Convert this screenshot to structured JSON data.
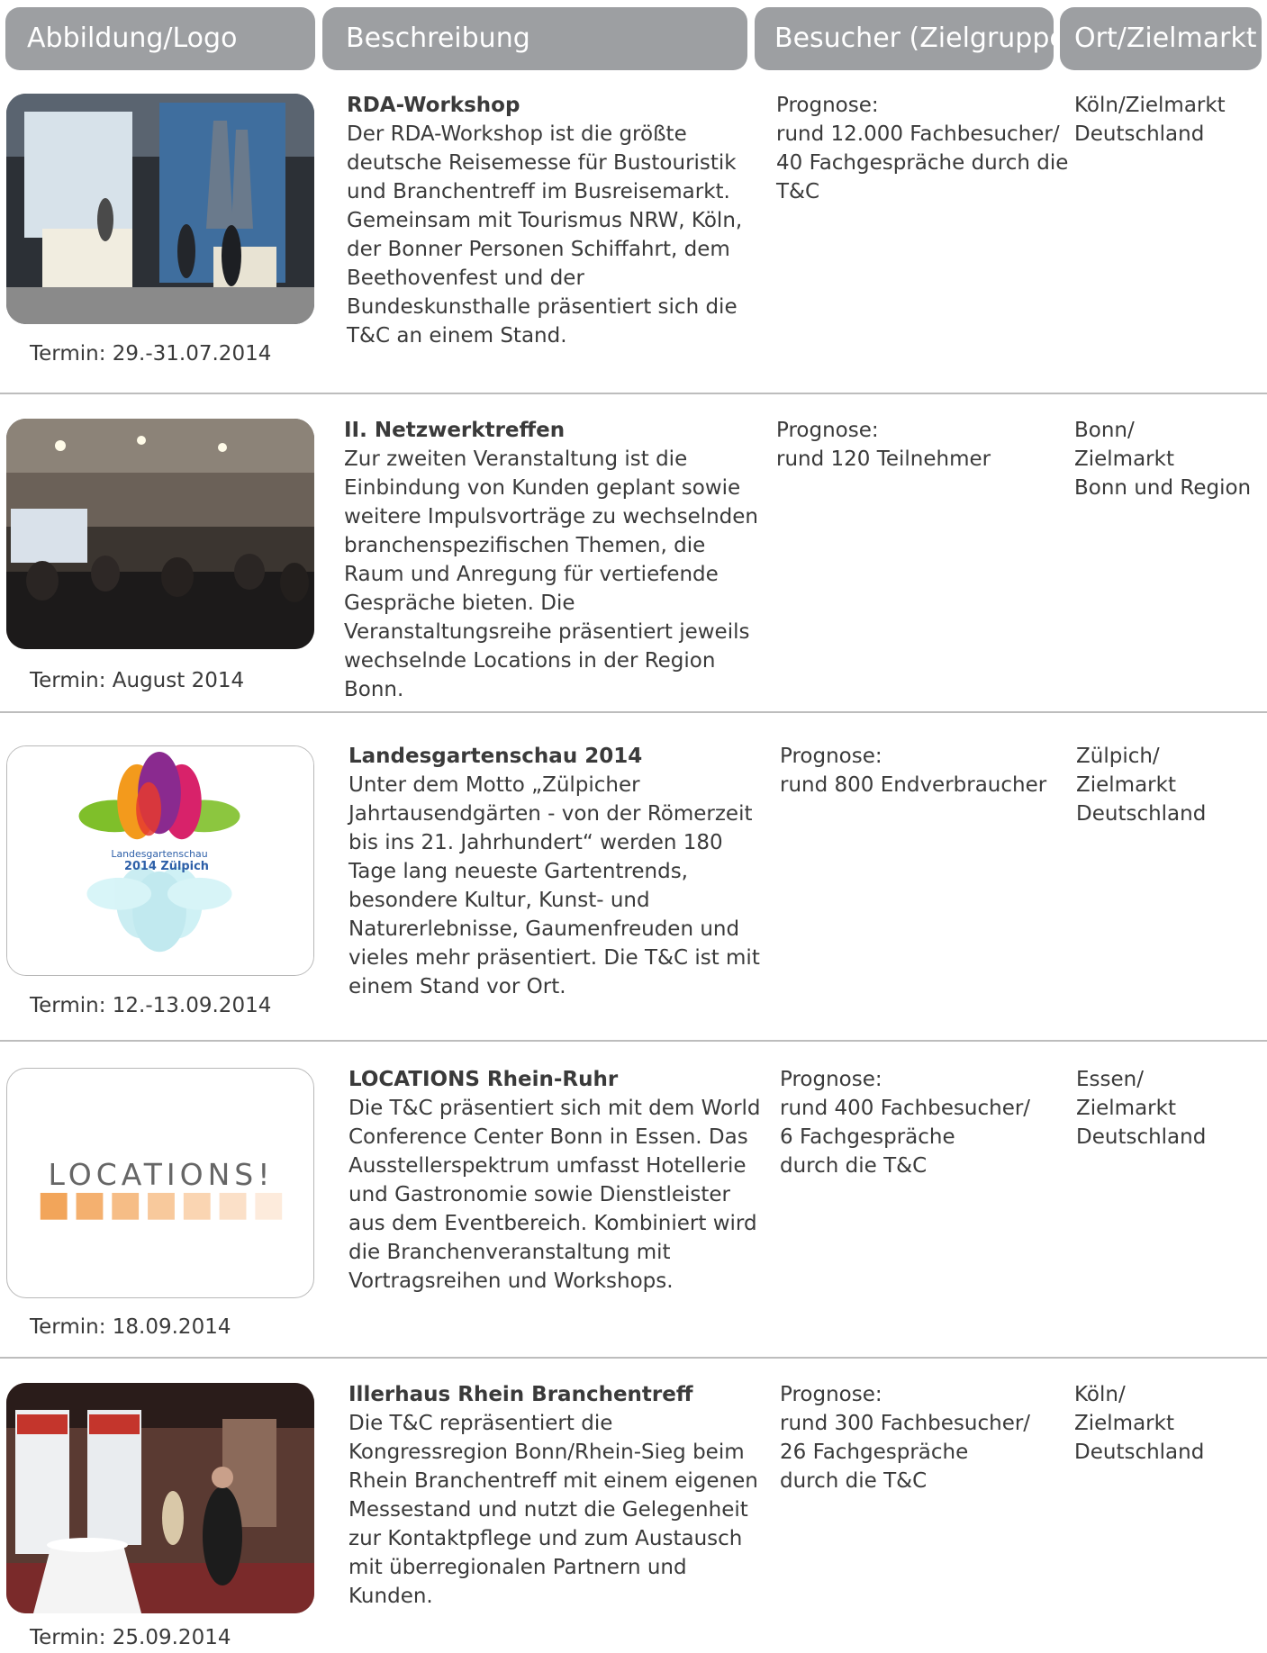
{
  "header": {
    "col_logo": "Abbildung/Logo",
    "col_desc": "Beschreibung",
    "col_visitors": "Besucher (Zielgruppe)",
    "col_location": "Ort/Zielmarkt"
  },
  "rows": [
    {
      "title": "RDA-Workshop",
      "body": "Der RDA-Workshop ist die größte deutsche Reisemesse für Bustouristik und Branchentreff im Busreisemarkt. Gemeinsam mit Tourismus NRW, Köln, der Bonner Personen Schiffahrt, dem Beethovenfest und der Bundeskunsthalle präsentiert sich die T&C an einem Stand.",
      "visitors": "Prognose:\nrund 12.000 Fachbesucher/\n40 Fachgespräche durch die T&C",
      "location": "Köln/Zielmarkt\nDeutschland",
      "termin": "Termin: 29.-31.07.2014"
    },
    {
      "title": "II. Netzwerktreffen",
      "body": "Zur zweiten Veranstaltung ist die Einbindung von Kunden geplant sowie weitere Impulsvorträge zu wechselnden branchenspezifischen Themen, die Raum und Anregung für vertiefende Gespräche bieten. Die Veranstaltungsreihe präsentiert jeweils wechselnde Locations in der Region Bonn.",
      "visitors": "Prognose:\nrund 120 Teilnehmer",
      "location": "Bonn/\nZielmarkt\nBonn und Region",
      "termin": "Termin:  August 2014"
    },
    {
      "title": "Landesgartenschau 2014",
      "body": "Unter dem Motto „Zülpicher Jahrtausendgärten - von der Römerzeit bis ins 21. Jahrhundert“ werden 180 Tage lang neueste Gartentrends, besondere Kultur, Kunst- und Naturerlebnisse, Gaumenfreuden und vieles mehr präsentiert. Die T&C ist mit einem Stand vor Ort.",
      "visitors": "Prognose:\nrund 800 Endverbraucher",
      "location": "Zülpich/\nZielmarkt\nDeutschland",
      "termin": "Termin: 12.-13.09.2014",
      "logo_line1": "Landesgartenschau",
      "logo_line2": "2014 Zülpich"
    },
    {
      "title": "LOCATIONS Rhein-Ruhr",
      "body": "Die T&C präsentiert sich mit dem World Conference Center Bonn in Essen. Das Ausstellerspektrum umfasst Hotellerie und Gastronomie sowie Dienstleister aus dem Eventbereich. Kombiniert wird die Branchenveranstaltung mit Vortragsreihen und Workshops.",
      "visitors": "Prognose:\nrund 400 Fachbesucher/\n6 Fachgespräche\ndurch die T&C",
      "location": "Essen/\nZielmarkt\nDeutschland",
      "termin": "Termin: 18.09.2014",
      "logo_text": "LOCATIONS!"
    },
    {
      "title": "Illerhaus Rhein Branchentreff",
      "body": "Die T&C repräsentiert die Kongressregion Bonn/Rhein-Sieg beim Rhein Branchentreff mit einem eigenen Messestand und nutzt die Gelegenheit zur Kontaktpflege und zum Austausch mit überregionalen Partnern und Kunden.",
      "visitors": "Prognose:\nrund 300 Fachbesucher/\n26 Fachgespräche\ndurch die T&C",
      "location": "Köln/\nZielmarkt\nDeutschland",
      "termin": "Termin: 25.09.2014"
    }
  ]
}
